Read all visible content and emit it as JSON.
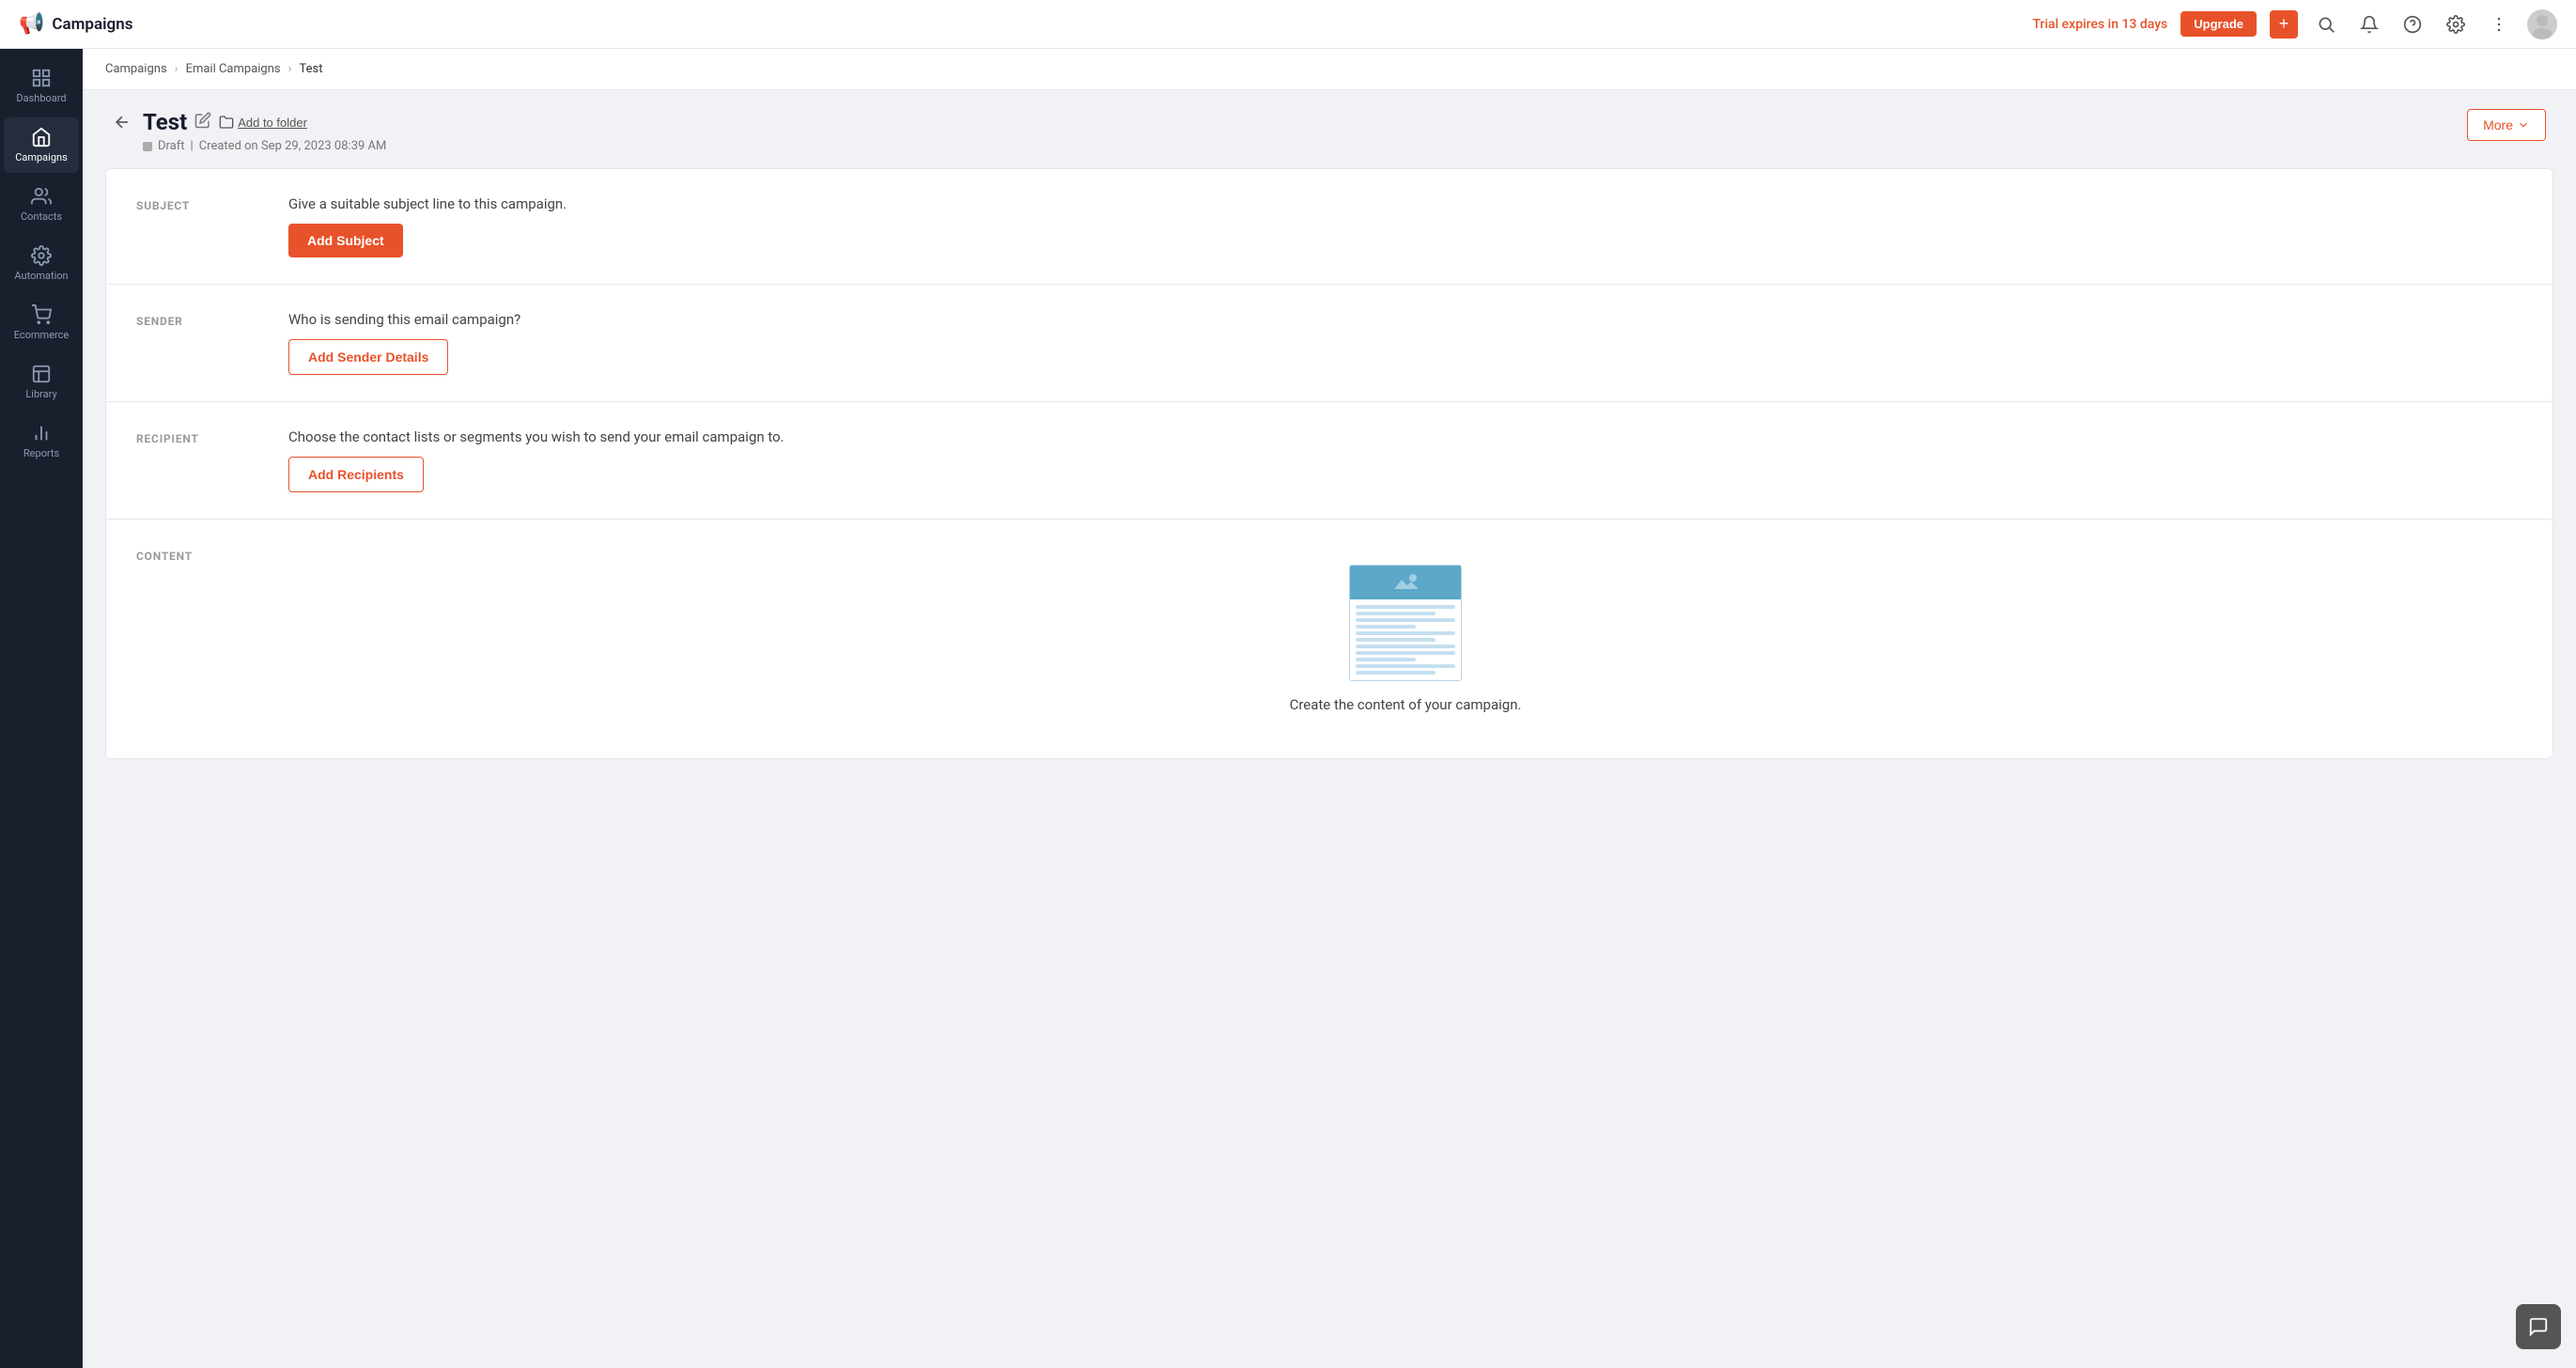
{
  "app": {
    "title": "Campaigns",
    "logo_emoji": "📢"
  },
  "topnav": {
    "trial_text": "Trial expires in 13 days",
    "upgrade_label": "Upgrade",
    "plus_label": "+",
    "search_title": "Search",
    "notifications_title": "Notifications",
    "help_title": "Help",
    "settings_title": "Settings",
    "more_title": "More"
  },
  "sidebar": {
    "items": [
      {
        "id": "dashboard",
        "label": "Dashboard",
        "active": false
      },
      {
        "id": "campaigns",
        "label": "Campaigns",
        "active": true
      },
      {
        "id": "contacts",
        "label": "Contacts",
        "active": false
      },
      {
        "id": "automation",
        "label": "Automation",
        "active": false
      },
      {
        "id": "ecommerce",
        "label": "Ecommerce",
        "active": false
      },
      {
        "id": "library",
        "label": "Library",
        "active": false
      },
      {
        "id": "reports",
        "label": "Reports",
        "active": false
      }
    ]
  },
  "breadcrumb": {
    "items": [
      {
        "label": "Campaigns",
        "href": "#"
      },
      {
        "label": "Email Campaigns",
        "href": "#"
      },
      {
        "label": "Test",
        "href": null
      }
    ]
  },
  "campaign": {
    "title": "Test",
    "add_to_folder_label": "Add to folder",
    "status": "Draft",
    "created_text": "Created on Sep 29, 2023 08:39 AM",
    "more_button_label": "More",
    "sections": [
      {
        "id": "subject",
        "label": "SUBJECT",
        "description": "Give a suitable subject line to this campaign.",
        "button_label": "Add Subject",
        "button_type": "primary"
      },
      {
        "id": "sender",
        "label": "SENDER",
        "description": "Who is sending this email campaign?",
        "button_label": "Add Sender Details",
        "button_type": "outline"
      },
      {
        "id": "recipient",
        "label": "RECIPIENT",
        "description": "Choose the contact lists or segments you wish to send your email campaign to.",
        "button_label": "Add Recipients",
        "button_type": "outline"
      },
      {
        "id": "content",
        "label": "CONTENT",
        "description": "Create the content of your campaign.",
        "button_label": null,
        "button_type": null
      }
    ]
  },
  "colors": {
    "accent": "#e8522a",
    "sidebar_bg": "#1a1f2e",
    "sidebar_active": "#252d3d"
  }
}
